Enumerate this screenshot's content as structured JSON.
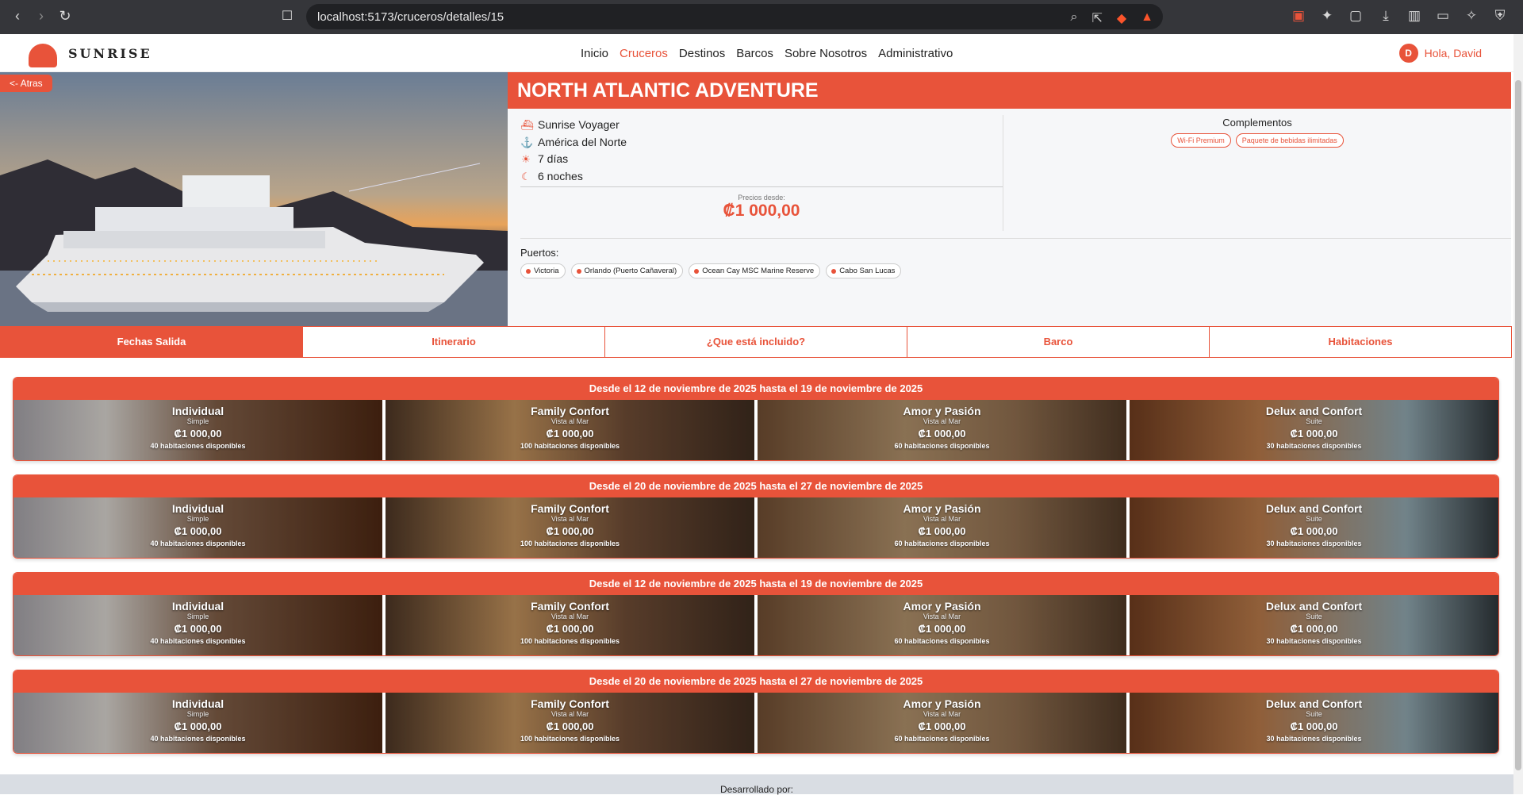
{
  "browser": {
    "url": "localhost:5173/cruceros/detalles/15"
  },
  "header": {
    "logo": "SUNRISE",
    "nav": [
      "Inicio",
      "Cruceros",
      "Destinos",
      "Barcos",
      "Sobre Nosotros",
      "Administrativo"
    ],
    "active_nav": "Cruceros",
    "user_initial": "D",
    "greeting": "Hola, David"
  },
  "back_label": "<- Atras",
  "cruise": {
    "title": "NORTH ATLANTIC ADVENTURE",
    "ship": "Sunrise Voyager",
    "region": "América del Norte",
    "days": "7 días",
    "nights": "6 noches",
    "price_label": "Precios desde:",
    "price": "₡1 000,00"
  },
  "complements": {
    "title": "Complementos",
    "items": [
      "Wi-Fi Premium",
      "Paquete de bebidas ilimitadas"
    ]
  },
  "ports": {
    "title": "Puertos:",
    "items": [
      "Victoria",
      "Orlando (Puerto Cañaveral)",
      "Ocean Cay MSC Marine Reserve",
      "Cabo San Lucas"
    ]
  },
  "tabs": [
    "Fechas Salida",
    "Itinerario",
    "¿Que está incluido?",
    "Barco",
    "Habitaciones"
  ],
  "rooms": [
    {
      "name": "Individual",
      "type": "Simple",
      "price": "₡1 000,00",
      "avail": "40 habitaciones disponibles"
    },
    {
      "name": "Family Confort",
      "type": "Vista al Mar",
      "price": "₡1 000,00",
      "avail": "100 habitaciones disponibles"
    },
    {
      "name": "Amor y Pasión",
      "type": "Vista al Mar",
      "price": "₡1 000,00",
      "avail": "60 habitaciones disponibles"
    },
    {
      "name": "Delux and Confort",
      "type": "Suite",
      "price": "₡1 000,00",
      "avail": "30 habitaciones disponibles"
    }
  ],
  "departures": [
    "Desde el 12 de noviembre de 2025 hasta el 19 de noviembre de 2025",
    "Desde el 20 de noviembre de 2025 hasta el 27 de noviembre de 2025",
    "Desde el 12 de noviembre de 2025 hasta el 19 de noviembre de 2025",
    "Desde el 20 de noviembre de 2025 hasta el 27 de noviembre de 2025"
  ],
  "footer": "Desarrollado por:",
  "colors": {
    "accent": "#e8533a"
  }
}
